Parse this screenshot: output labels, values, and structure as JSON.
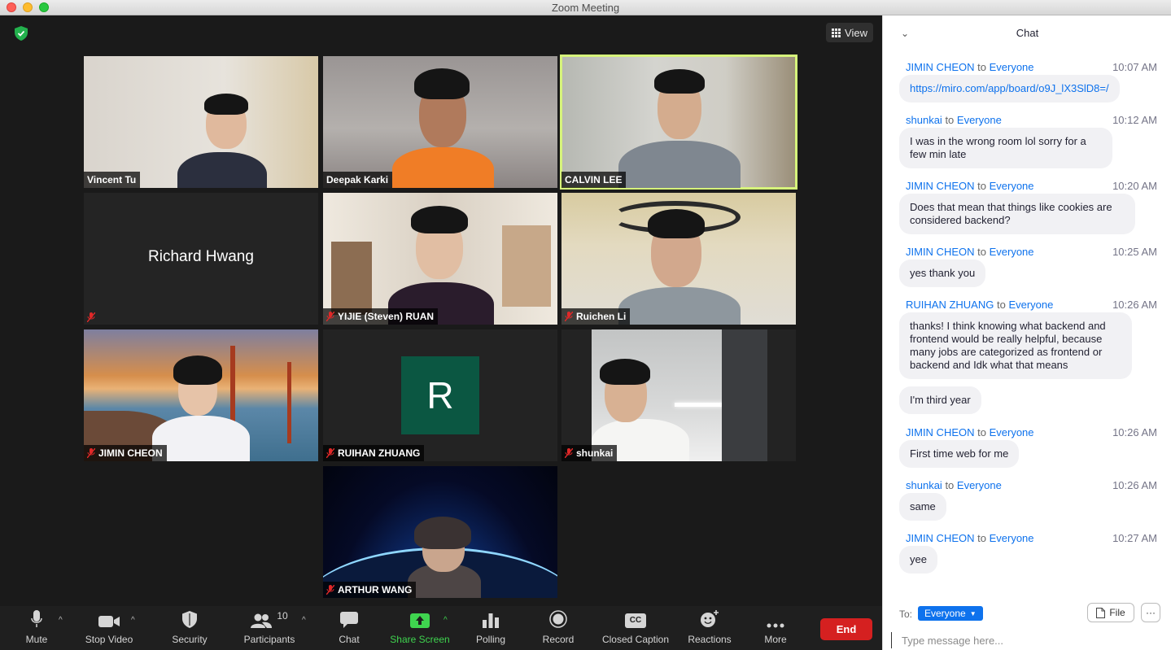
{
  "window": {
    "title": "Zoom Meeting"
  },
  "view": {
    "label": "View"
  },
  "participants": [
    {
      "name": "Vincent Tu",
      "muted": false
    },
    {
      "name": "Deepak Karki",
      "muted": false
    },
    {
      "name": "CALVIN LEE",
      "muted": false,
      "speaking": true
    },
    {
      "name": "Richard Hwang",
      "muted": true,
      "video_off": true
    },
    {
      "name": "YIJIE (Steven) RUAN",
      "muted": true
    },
    {
      "name": "Ruichen Li",
      "muted": true
    },
    {
      "name": "JIMIN CHEON",
      "muted": true
    },
    {
      "name": "RUIHAN ZHUANG",
      "muted": true,
      "avatar_letter": "R"
    },
    {
      "name": "shunkai",
      "muted": true
    },
    {
      "name": "ARTHUR WANG",
      "muted": true
    }
  ],
  "toolbar": {
    "mute": "Mute",
    "stop_video": "Stop Video",
    "security": "Security",
    "participants": "Participants",
    "participants_count": "10",
    "chat": "Chat",
    "share_screen": "Share Screen",
    "polling": "Polling",
    "record": "Record",
    "closed_caption": "Closed Caption",
    "closed_caption_icon": "CC",
    "reactions": "Reactions",
    "more": "More",
    "end": "End"
  },
  "chat": {
    "title": "Chat",
    "to_word": "to",
    "messages": [
      {
        "sender": "JIMIN CHEON",
        "to": "Everyone",
        "time": "10:07 AM",
        "text": "https://miro.com/app/board/o9J_lX3SlD8=/"
      },
      {
        "sender": "shunkai",
        "to": "Everyone",
        "time": "10:12 AM",
        "text": "I was in the wrong room lol sorry for a few min late"
      },
      {
        "sender": "JIMIN CHEON",
        "to": "Everyone",
        "time": "10:20 AM",
        "text": "Does that mean that things like cookies are considered backend?"
      },
      {
        "sender": "JIMIN CHEON",
        "to": "Everyone",
        "time": "10:25 AM",
        "text": "yes thank you"
      },
      {
        "sender": "RUIHAN ZHUANG",
        "to": "Everyone",
        "time": "10:26 AM",
        "text": "thanks! I think knowing what backend and frontend would be really helpful, because many jobs are categorized as frontend or backend and Idk what that means"
      },
      {
        "text": "I'm third year"
      },
      {
        "sender": "JIMIN CHEON",
        "to": "Everyone",
        "time": "10:26 AM",
        "text": "First time web for me"
      },
      {
        "sender": "shunkai",
        "to": "Everyone",
        "time": "10:26 AM",
        "text": "same"
      },
      {
        "sender": "JIMIN CHEON",
        "to": "Everyone",
        "time": "10:27 AM",
        "text": "yee"
      }
    ],
    "to_label": "To:",
    "recipient": "Everyone",
    "file_label": "File",
    "more_label": "···",
    "input_placeholder": "Type message here..."
  }
}
